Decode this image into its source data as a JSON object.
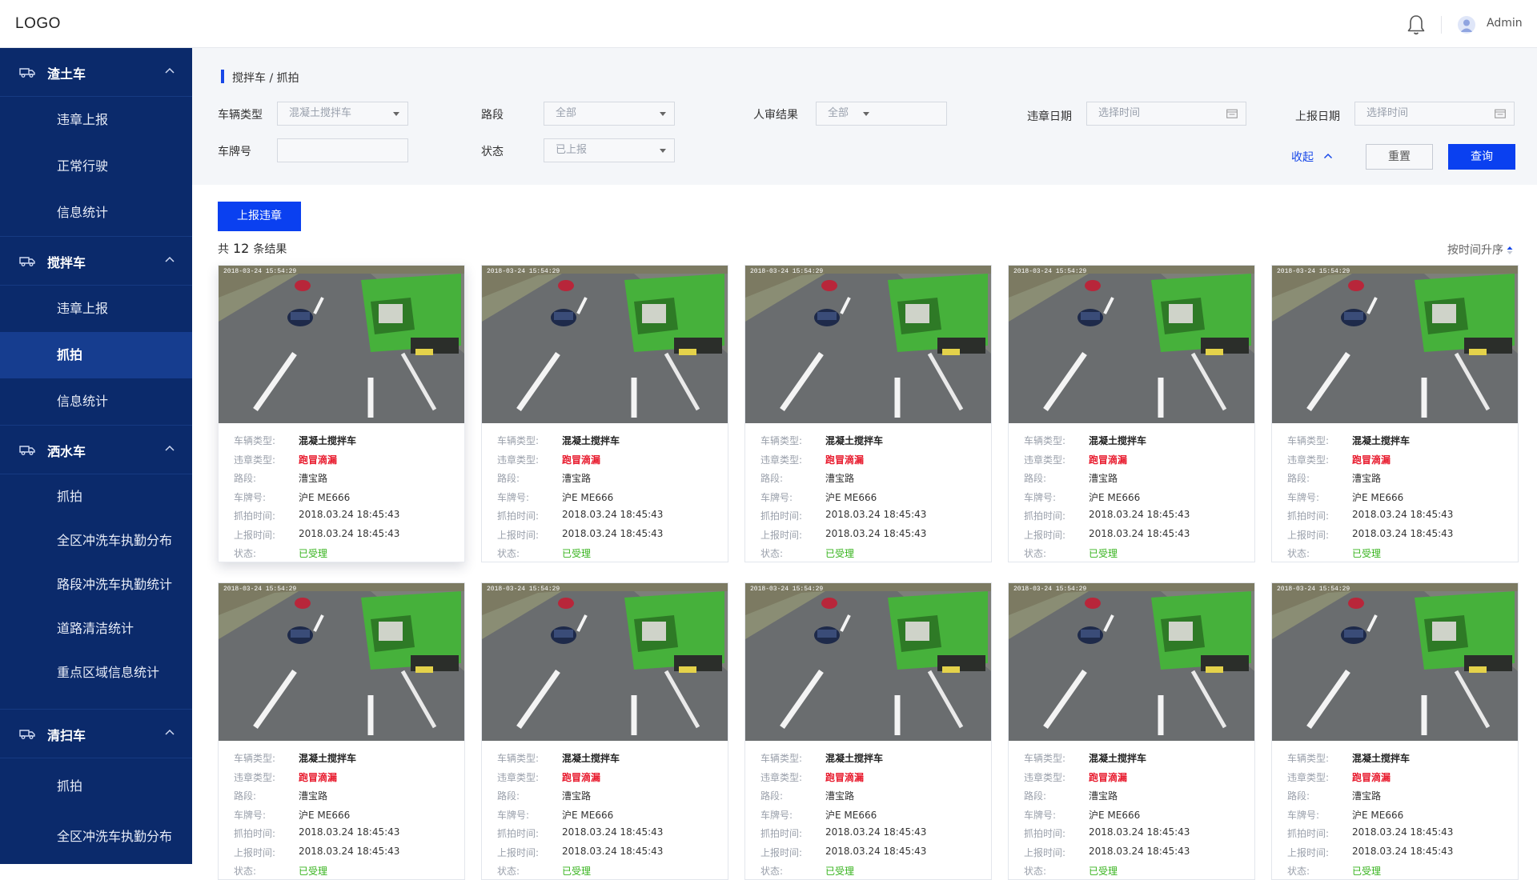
{
  "header": {
    "logo": "LOGO",
    "user": "Admin"
  },
  "sidebar": {
    "groups": [
      {
        "label": "渣土车",
        "items": [
          {
            "label": "违章上报"
          },
          {
            "label": "正常行驶"
          },
          {
            "label": "信息统计"
          }
        ]
      },
      {
        "label": "搅拌车",
        "items": [
          {
            "label": "违章上报"
          },
          {
            "label": "抓拍"
          },
          {
            "label": "信息统计"
          }
        ]
      },
      {
        "label": "洒水车",
        "items": [
          {
            "label": "抓拍"
          },
          {
            "label": "全区冲洗车执勤分布"
          },
          {
            "label": "路段冲洗车执勤统计"
          },
          {
            "label": "道路清洁统计"
          },
          {
            "label": "重点区域信息统计"
          }
        ]
      },
      {
        "label": "清扫车",
        "items": [
          {
            "label": "抓拍"
          },
          {
            "label": "全区冲洗车执勤分布"
          }
        ]
      }
    ],
    "active": "搅拌车 / 抓拍"
  },
  "breadcrumb": "搅拌车 / 抓拍",
  "filters": {
    "vehicle_type": {
      "label": "车辆类型",
      "value": "混凝土搅拌车"
    },
    "road": {
      "label": "路段",
      "value": "全部"
    },
    "review": {
      "label": "人审结果",
      "value": "全部"
    },
    "violation_date": {
      "label": "违章日期",
      "placeholder": "选择时间"
    },
    "report_date": {
      "label": "上报日期",
      "placeholder": "选择时间"
    },
    "plate": {
      "label": "车牌号",
      "value": ""
    },
    "status": {
      "label": "状态",
      "value": "已上报"
    },
    "collapse": "收起",
    "reset": "重置",
    "query": "查询"
  },
  "actions": {
    "report_button": "上报违章"
  },
  "results": {
    "prefix": "共",
    "count": "12",
    "suffix": "条结果",
    "sort": "按时间升序"
  },
  "card": {
    "labels": {
      "vehicle_type": "车辆类型:",
      "violation_type": "违章类型:",
      "road": "路段:",
      "plate": "车牌号:",
      "capture_time": "抓拍时间:",
      "report_time": "上报时间:",
      "status": "状态:"
    },
    "camera_overlay": "2018-03-24    15:54:29"
  },
  "records": [
    {
      "vehicle_type": "混凝土搅拌车",
      "violation_type": "跑冒滴漏",
      "road": "漕宝路",
      "plate": "沪E ME666",
      "capture_time": "2018.03.24 18:45:43",
      "report_time": "2018.03.24 18:45:43",
      "status": "已受理"
    },
    {
      "vehicle_type": "混凝土搅拌车",
      "violation_type": "跑冒滴漏",
      "road": "漕宝路",
      "plate": "沪E ME666",
      "capture_time": "2018.03.24 18:45:43",
      "report_time": "2018.03.24 18:45:43",
      "status": "已受理"
    },
    {
      "vehicle_type": "混凝土搅拌车",
      "violation_type": "跑冒滴漏",
      "road": "漕宝路",
      "plate": "沪E ME666",
      "capture_time": "2018.03.24 18:45:43",
      "report_time": "2018.03.24 18:45:43",
      "status": "已受理"
    },
    {
      "vehicle_type": "混凝土搅拌车",
      "violation_type": "跑冒滴漏",
      "road": "漕宝路",
      "plate": "沪E ME666",
      "capture_time": "2018.03.24 18:45:43",
      "report_time": "2018.03.24 18:45:43",
      "status": "已受理"
    },
    {
      "vehicle_type": "混凝土搅拌车",
      "violation_type": "跑冒滴漏",
      "road": "漕宝路",
      "plate": "沪E ME666",
      "capture_time": "2018.03.24 18:45:43",
      "report_time": "2018.03.24 18:45:43",
      "status": "已受理"
    },
    {
      "vehicle_type": "混凝土搅拌车",
      "violation_type": "跑冒滴漏",
      "road": "漕宝路",
      "plate": "沪E ME666",
      "capture_time": "2018.03.24 18:45:43",
      "report_time": "2018.03.24 18:45:43",
      "status": "已受理"
    },
    {
      "vehicle_type": "混凝土搅拌车",
      "violation_type": "跑冒滴漏",
      "road": "漕宝路",
      "plate": "沪E ME666",
      "capture_time": "2018.03.24 18:45:43",
      "report_time": "2018.03.24 18:45:43",
      "status": "已受理"
    },
    {
      "vehicle_type": "混凝土搅拌车",
      "violation_type": "跑冒滴漏",
      "road": "漕宝路",
      "plate": "沪E ME666",
      "capture_time": "2018.03.24 18:45:43",
      "report_time": "2018.03.24 18:45:43",
      "status": "已受理"
    },
    {
      "vehicle_type": "混凝土搅拌车",
      "violation_type": "跑冒滴漏",
      "road": "漕宝路",
      "plate": "沪E ME666",
      "capture_time": "2018.03.24 18:45:43",
      "report_time": "2018.03.24 18:45:43",
      "status": "已受理"
    },
    {
      "vehicle_type": "混凝土搅拌车",
      "violation_type": "跑冒滴漏",
      "road": "漕宝路",
      "plate": "沪E ME666",
      "capture_time": "2018.03.24 18:45:43",
      "report_time": "2018.03.24 18:45:43",
      "status": "已受理"
    }
  ],
  "colors": {
    "sidebar": "#0b2a6b",
    "sidebar_active": "#163d8f",
    "primary": "#0a40f0",
    "danger": "#e8192c",
    "success": "#36b31c",
    "truck": "#3fae3a"
  }
}
